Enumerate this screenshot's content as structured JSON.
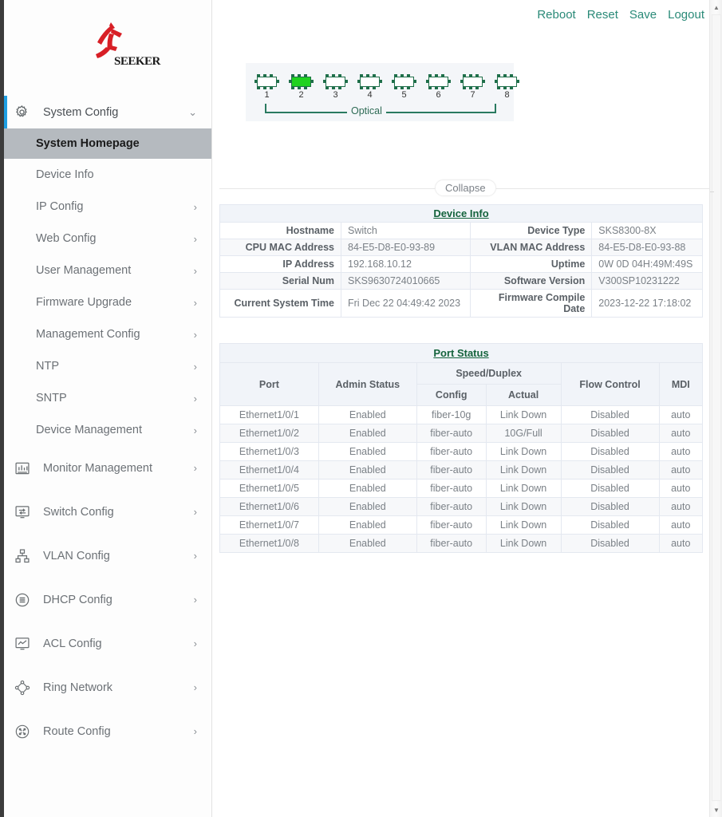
{
  "brand": {
    "name": "SEEKER",
    "logo_color": "#d81f26"
  },
  "topbar": {
    "links": [
      {
        "label": "Reboot",
        "name": "reboot-link"
      },
      {
        "label": "Reset",
        "name": "reset-link"
      },
      {
        "label": "Save",
        "name": "save-link"
      },
      {
        "label": "Logout",
        "name": "logout-link"
      }
    ],
    "link_color": "#2a8a78"
  },
  "sidebar": {
    "group": {
      "label": "System Config",
      "icon": "gear-icon",
      "chevron": "chevron-down-icon",
      "accent_color": "#1e9fe3"
    },
    "sub_items": [
      {
        "label": "System Homepage",
        "active": true,
        "chevron": ""
      },
      {
        "label": "Device Info",
        "active": false,
        "chevron": ""
      },
      {
        "label": "IP Config",
        "active": false,
        "chevron": "›"
      },
      {
        "label": "Web Config",
        "active": false,
        "chevron": "›"
      },
      {
        "label": "User Management",
        "active": false,
        "chevron": "›"
      },
      {
        "label": "Firmware Upgrade",
        "active": false,
        "chevron": "›"
      },
      {
        "label": "Management Config",
        "active": false,
        "chevron": "›"
      },
      {
        "label": "NTP",
        "active": false,
        "chevron": "›"
      },
      {
        "label": "SNTP",
        "active": false,
        "chevron": "›"
      },
      {
        "label": "Device Management",
        "active": false,
        "chevron": "›"
      }
    ],
    "items": [
      {
        "label": "Monitor Management",
        "icon": "chart-bar-icon",
        "chevron": "›"
      },
      {
        "label": "Switch Config",
        "icon": "switch-monitor-icon",
        "chevron": "›"
      },
      {
        "label": "VLAN Config",
        "icon": "hierarchy-icon",
        "chevron": "›"
      },
      {
        "label": "DHCP Config",
        "icon": "list-circle-icon",
        "chevron": "›"
      },
      {
        "label": "ACL Config",
        "icon": "monitor-wave-icon",
        "chevron": "›"
      },
      {
        "label": "Ring Network",
        "icon": "ring-nodes-icon",
        "chevron": "›"
      },
      {
        "label": "Route Config",
        "icon": "route-dots-icon",
        "chevron": "›"
      }
    ]
  },
  "port_panel": {
    "ports": [
      {
        "num": "1",
        "state": "down"
      },
      {
        "num": "2",
        "state": "up"
      },
      {
        "num": "3",
        "state": "down"
      },
      {
        "num": "4",
        "state": "down"
      },
      {
        "num": "5",
        "state": "down"
      },
      {
        "num": "6",
        "state": "down"
      },
      {
        "num": "7",
        "state": "down"
      },
      {
        "num": "8",
        "state": "down"
      }
    ],
    "bracket_label": "Optical",
    "up_color": "#1fd21f",
    "outline_color": "#1f6f4a"
  },
  "collapse": {
    "label": "Collapse"
  },
  "device_info": {
    "title": "Device Info",
    "rows": [
      {
        "l1": "Hostname",
        "v1": "Switch",
        "l2": "Device Type",
        "v2": "SKS8300-8X",
        "shade": false
      },
      {
        "l1": "CPU MAC Address",
        "v1": "84-E5-D8-E0-93-89",
        "l2": "VLAN MAC Address",
        "v2": "84-E5-D8-E0-93-88",
        "shade": true
      },
      {
        "l1": "IP Address",
        "v1": "192.168.10.12",
        "l2": "Uptime",
        "v2": "0W 0D 04H:49M:49S",
        "shade": false
      },
      {
        "l1": "Serial Num",
        "v1": "SKS9630724010665",
        "l2": "Software Version",
        "v2": "V300SP10231222",
        "shade": true
      },
      {
        "l1": "Current System Time",
        "v1": "Fri Dec 22 04:49:42 2023",
        "l2": "Firmware Compile Date",
        "v2": "2023-12-22 17:18:02",
        "shade": false
      }
    ]
  },
  "port_status": {
    "title": "Port Status",
    "headers": {
      "port": "Port",
      "admin_status": "Admin Status",
      "speed_duplex": "Speed/Duplex",
      "config": "Config",
      "actual": "Actual",
      "flow_control": "Flow Control",
      "mdi": "MDI"
    },
    "rows": [
      {
        "port": "Ethernet1/0/1",
        "admin": "Enabled",
        "config": "fiber-10g",
        "actual": "Link Down",
        "flow": "Disabled",
        "mdi": "auto",
        "shade": false
      },
      {
        "port": "Ethernet1/0/2",
        "admin": "Enabled",
        "config": "fiber-auto",
        "actual": "10G/Full",
        "flow": "Disabled",
        "mdi": "auto",
        "shade": true
      },
      {
        "port": "Ethernet1/0/3",
        "admin": "Enabled",
        "config": "fiber-auto",
        "actual": "Link Down",
        "flow": "Disabled",
        "mdi": "auto",
        "shade": false
      },
      {
        "port": "Ethernet1/0/4",
        "admin": "Enabled",
        "config": "fiber-auto",
        "actual": "Link Down",
        "flow": "Disabled",
        "mdi": "auto",
        "shade": true
      },
      {
        "port": "Ethernet1/0/5",
        "admin": "Enabled",
        "config": "fiber-auto",
        "actual": "Link Down",
        "flow": "Disabled",
        "mdi": "auto",
        "shade": false
      },
      {
        "port": "Ethernet1/0/6",
        "admin": "Enabled",
        "config": "fiber-auto",
        "actual": "Link Down",
        "flow": "Disabled",
        "mdi": "auto",
        "shade": true
      },
      {
        "port": "Ethernet1/0/7",
        "admin": "Enabled",
        "config": "fiber-auto",
        "actual": "Link Down",
        "flow": "Disabled",
        "mdi": "auto",
        "shade": false
      },
      {
        "port": "Ethernet1/0/8",
        "admin": "Enabled",
        "config": "fiber-auto",
        "actual": "Link Down",
        "flow": "Disabled",
        "mdi": "auto",
        "shade": true
      }
    ]
  },
  "scrollbar": {
    "up": "▲",
    "down": "▼"
  }
}
